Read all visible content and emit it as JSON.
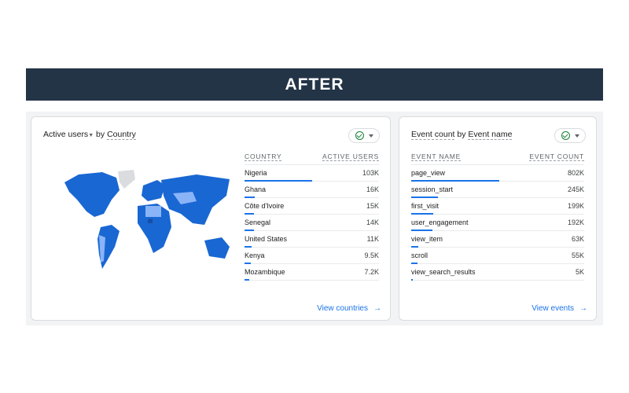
{
  "banner": {
    "title": "AFTER"
  },
  "countries_card": {
    "metric": "Active users",
    "dimension_prefix": "by",
    "dimension": "Country",
    "columns": [
      "COUNTRY",
      "ACTIVE USERS"
    ],
    "rows": [
      {
        "name": "Nigeria",
        "value": "103K",
        "fraction": 1.0
      },
      {
        "name": "Ghana",
        "value": "16K",
        "fraction": 0.155
      },
      {
        "name": "Côte d'Ivoire",
        "value": "15K",
        "fraction": 0.146
      },
      {
        "name": "Senegal",
        "value": "14K",
        "fraction": 0.136
      },
      {
        "name": "United States",
        "value": "11K",
        "fraction": 0.107
      },
      {
        "name": "Kenya",
        "value": "9.5K",
        "fraction": 0.092
      },
      {
        "name": "Mozambique",
        "value": "7.2K",
        "fraction": 0.07
      }
    ],
    "link": "View countries"
  },
  "events_card": {
    "title_metric": "Event count",
    "title_prefix": "by",
    "title_dimension": "Event name",
    "columns": [
      "EVENT NAME",
      "EVENT COUNT"
    ],
    "rows": [
      {
        "name": "page_view",
        "value": "802K",
        "fraction": 1.0
      },
      {
        "name": "session_start",
        "value": "245K",
        "fraction": 0.305
      },
      {
        "name": "first_visit",
        "value": "199K",
        "fraction": 0.248
      },
      {
        "name": "user_engagement",
        "value": "192K",
        "fraction": 0.239
      },
      {
        "name": "view_item",
        "value": "63K",
        "fraction": 0.079
      },
      {
        "name": "scroll",
        "value": "55K",
        "fraction": 0.069
      },
      {
        "name": "view_search_results",
        "value": "5K",
        "fraction": 0.006
      }
    ],
    "link": "View events"
  },
  "colors": {
    "accent": "#1a73e8",
    "map_dark": "#1967d2",
    "map_light": "#8ab4f8",
    "banner": "#243447"
  }
}
